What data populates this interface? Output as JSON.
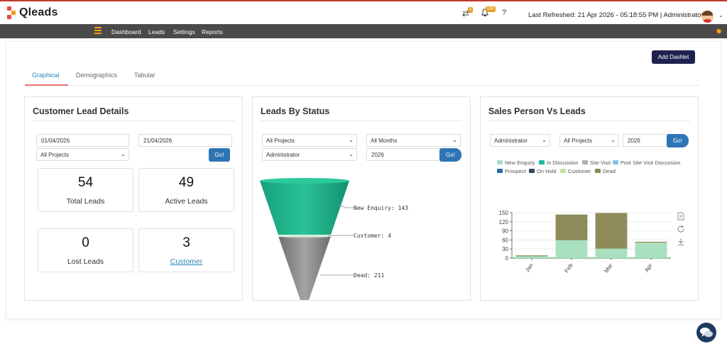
{
  "app": {
    "name": "Qleads"
  },
  "header": {
    "transfer_badge": "0",
    "notif_badge": "180",
    "help": "?",
    "last_refreshed": "Last Refreshed: 21 Apr 2026 - 05:18:55 PM | Administrator"
  },
  "nav": [
    "Dashboard",
    "Leads",
    "Settings",
    "Reports"
  ],
  "add_dashlet": "Add Dashlet",
  "tabs": [
    "Graphical",
    "Demographics",
    "Tabular"
  ],
  "customer_lead": {
    "title": "Customer Lead Details",
    "from_date": "01/04/2026",
    "to_date": "21/04/2026",
    "project": "All Projects",
    "go": "Go!",
    "stats": [
      {
        "value": "54",
        "label": "Total Leads"
      },
      {
        "value": "49",
        "label": "Active Leads"
      },
      {
        "value": "0",
        "label": "Lost Leads"
      },
      {
        "value": "3",
        "label": "Customer"
      }
    ]
  },
  "leads_status": {
    "title": "Leads By Status",
    "project": "All Projects",
    "month": "All Months",
    "user": "Administrator",
    "year": "2026",
    "go": "Go!",
    "funnel": [
      {
        "label": "New Enquiry: 143",
        "color": "#1aa57f"
      },
      {
        "label": "Customer: 4",
        "color": "#a5d6a7"
      },
      {
        "label": "Dead: 211",
        "color": "#8c8c8c"
      }
    ]
  },
  "sales_person": {
    "title": "Sales Person Vs Leads",
    "user": "Administrator",
    "project": "All Projects",
    "year": "2026",
    "go": "Go!",
    "legend": [
      {
        "name": "New Enquiry",
        "color": "#a8e0c0"
      },
      {
        "name": "In Discussion",
        "color": "#1abc9c"
      },
      {
        "name": "Site Visit",
        "color": "#b0b0b0"
      },
      {
        "name": "Post Site Visit Discussion",
        "color": "#85c1e9"
      },
      {
        "name": "Prospect",
        "color": "#2e6da4"
      },
      {
        "name": "On Hold",
        "color": "#34495e"
      },
      {
        "name": "Customer",
        "color": "#c5e1a5"
      },
      {
        "name": "Dead",
        "color": "#8d8b5a"
      }
    ]
  },
  "chart_data": {
    "type": "bar",
    "stacked": true,
    "categories": [
      "Jan",
      "Feb",
      "Mar",
      "Apr"
    ],
    "series": [
      {
        "name": "New Enquiry",
        "color": "#a8e0c0",
        "values": [
          6,
          59,
          31,
          49
        ]
      },
      {
        "name": "Customer",
        "color": "#c5e1a5",
        "values": [
          0,
          0,
          0,
          2
        ]
      },
      {
        "name": "Dead",
        "color": "#8d8b5a",
        "values": [
          3,
          85,
          118,
          3
        ]
      }
    ],
    "ylim": [
      0,
      150
    ],
    "yticks": [
      0,
      30,
      60,
      90,
      120,
      150
    ],
    "grid": true
  }
}
